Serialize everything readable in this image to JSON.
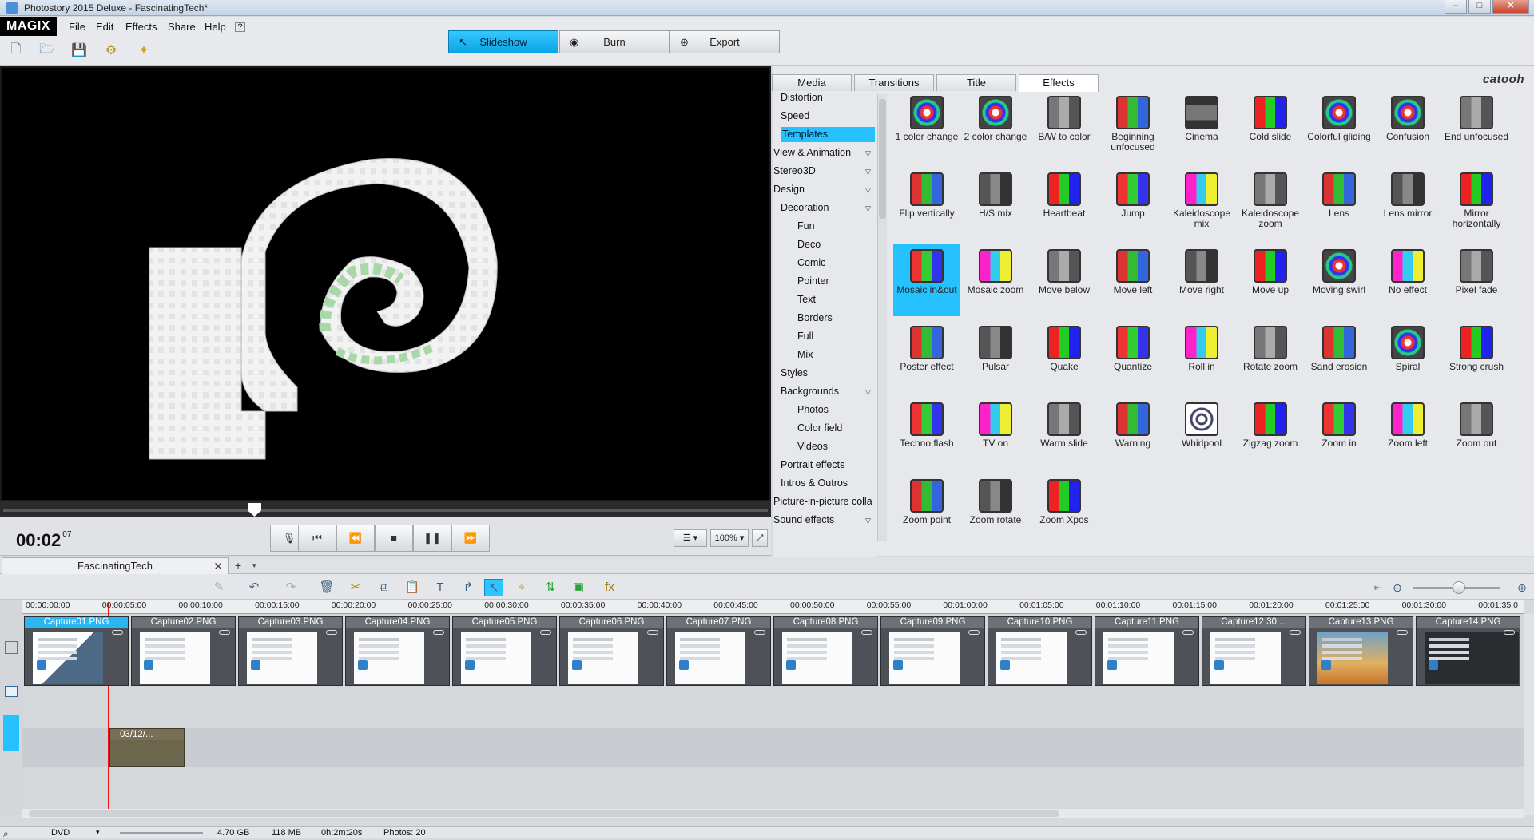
{
  "window": {
    "title": "Photostory 2015 Deluxe - FascinatingTech*"
  },
  "menu": {
    "logo": "MAGIX",
    "items": [
      "File",
      "Edit",
      "Effects",
      "Share",
      "Help"
    ]
  },
  "modes": [
    {
      "label": "Slideshow",
      "active": true,
      "icon": "cursor-icon"
    },
    {
      "label": "Burn",
      "active": false,
      "icon": "disc-icon"
    },
    {
      "label": "Export",
      "active": false,
      "icon": "globe-icon"
    }
  ],
  "preview": {
    "timecode": "00:02",
    "frames": "07",
    "zoom": "100%"
  },
  "tabs": [
    {
      "label": "Media",
      "active": false
    },
    {
      "label": "Transitions",
      "active": false
    },
    {
      "label": "Title",
      "active": false
    },
    {
      "label": "Effects",
      "active": true
    }
  ],
  "brand": "catooh",
  "categories": [
    {
      "label": "Distortion",
      "level": 1
    },
    {
      "label": "Speed",
      "level": 1
    },
    {
      "label": "Templates",
      "level": 1,
      "selected": true
    },
    {
      "label": "View & Animation",
      "level": 0,
      "dropdown": true
    },
    {
      "label": "Stereo3D",
      "level": 0,
      "dropdown": true
    },
    {
      "label": "Design",
      "level": 0,
      "dropdown": true
    },
    {
      "label": "Decoration",
      "level": 1,
      "dropdown": true
    },
    {
      "label": "Fun",
      "level": 2
    },
    {
      "label": "Deco",
      "level": 2
    },
    {
      "label": "Comic",
      "level": 2
    },
    {
      "label": "Pointer",
      "level": 2
    },
    {
      "label": "Text",
      "level": 2
    },
    {
      "label": "Borders",
      "level": 2
    },
    {
      "label": "Full",
      "level": 2
    },
    {
      "label": "Mix",
      "level": 2
    },
    {
      "label": "Styles",
      "level": 1
    },
    {
      "label": "Backgrounds",
      "level": 1,
      "dropdown": true
    },
    {
      "label": "Photos",
      "level": 2
    },
    {
      "label": "Color field",
      "level": 2
    },
    {
      "label": "Videos",
      "level": 2
    },
    {
      "label": "Portrait effects",
      "level": 1
    },
    {
      "label": "Intros & Outros",
      "level": 1
    },
    {
      "label": "Picture-in-picture colla",
      "level": 0
    },
    {
      "label": "Sound effects",
      "level": 0,
      "dropdown": true
    }
  ],
  "effects": [
    "1 color change",
    "2 color change",
    "B/W to color",
    "Beginning unfocused",
    "Cinema",
    "Cold slide",
    "Colorful gliding",
    "Confusion",
    "End unfocused",
    "Flip vertically",
    "H/S mix",
    "Heartbeat",
    "Jump",
    "Kaleidoscope mix",
    "Kaleidoscope zoom",
    "Lens",
    "Lens mirror",
    "Mirror horizontally",
    "Mosaic in&out",
    "Mosaic zoom",
    "Move below",
    "Move left",
    "Move right",
    "Move up",
    "Moving swirl",
    "No effect",
    "Pixel fade",
    "Poster effect",
    "Pulsar",
    "Quake",
    "Quantize",
    "Roll in",
    "Rotate zoom",
    "Sand erosion",
    "Spiral",
    "Strong crush",
    "Techno flash",
    "TV on",
    "Warm slide",
    "Warning",
    "Whirlpool",
    "Zigzag zoom",
    "Zoom in",
    "Zoom left",
    "Zoom out",
    "Zoom point",
    "Zoom rotate",
    "Zoom Xpos"
  ],
  "selected_effect": "Mosaic in&out",
  "timeline": {
    "tab": "FascinatingTech",
    "ruler": [
      "00:00:00:00",
      "00:00:05:00",
      "00:00:10:00",
      "00:00:15:00",
      "00:00:20:00",
      "00:00:25:00",
      "00:00:30:00",
      "00:00:35:00",
      "00:00:40:00",
      "00:00:45:00",
      "00:00:50:00",
      "00:00:55:00",
      "00:01:00:00",
      "00:01:05:00",
      "00:01:10:00",
      "00:01:15:00",
      "00:01:20:00",
      "00:01:25:00",
      "00:01:30:00",
      "00:01:35:0"
    ],
    "clips": [
      "Capture01.PNG",
      "Capture02.PNG",
      "Capture03.PNG",
      "Capture04.PNG",
      "Capture05.PNG",
      "Capture06.PNG",
      "Capture07.PNG",
      "Capture08.PNG",
      "Capture09.PNG",
      "Capture10.PNG",
      "Capture11.PNG",
      "Capture12 30 ...",
      "Capture13.PNG",
      "Capture14.PNG"
    ],
    "text_clip": "03/12/..."
  },
  "status": {
    "format": "DVD",
    "capacity": "4.70 GB",
    "size": "118 MB",
    "duration": "0h:2m:20s",
    "photos": "Photos: 20"
  },
  "colors": {
    "accent": "#26c1ff",
    "playhead": "#e11111"
  }
}
